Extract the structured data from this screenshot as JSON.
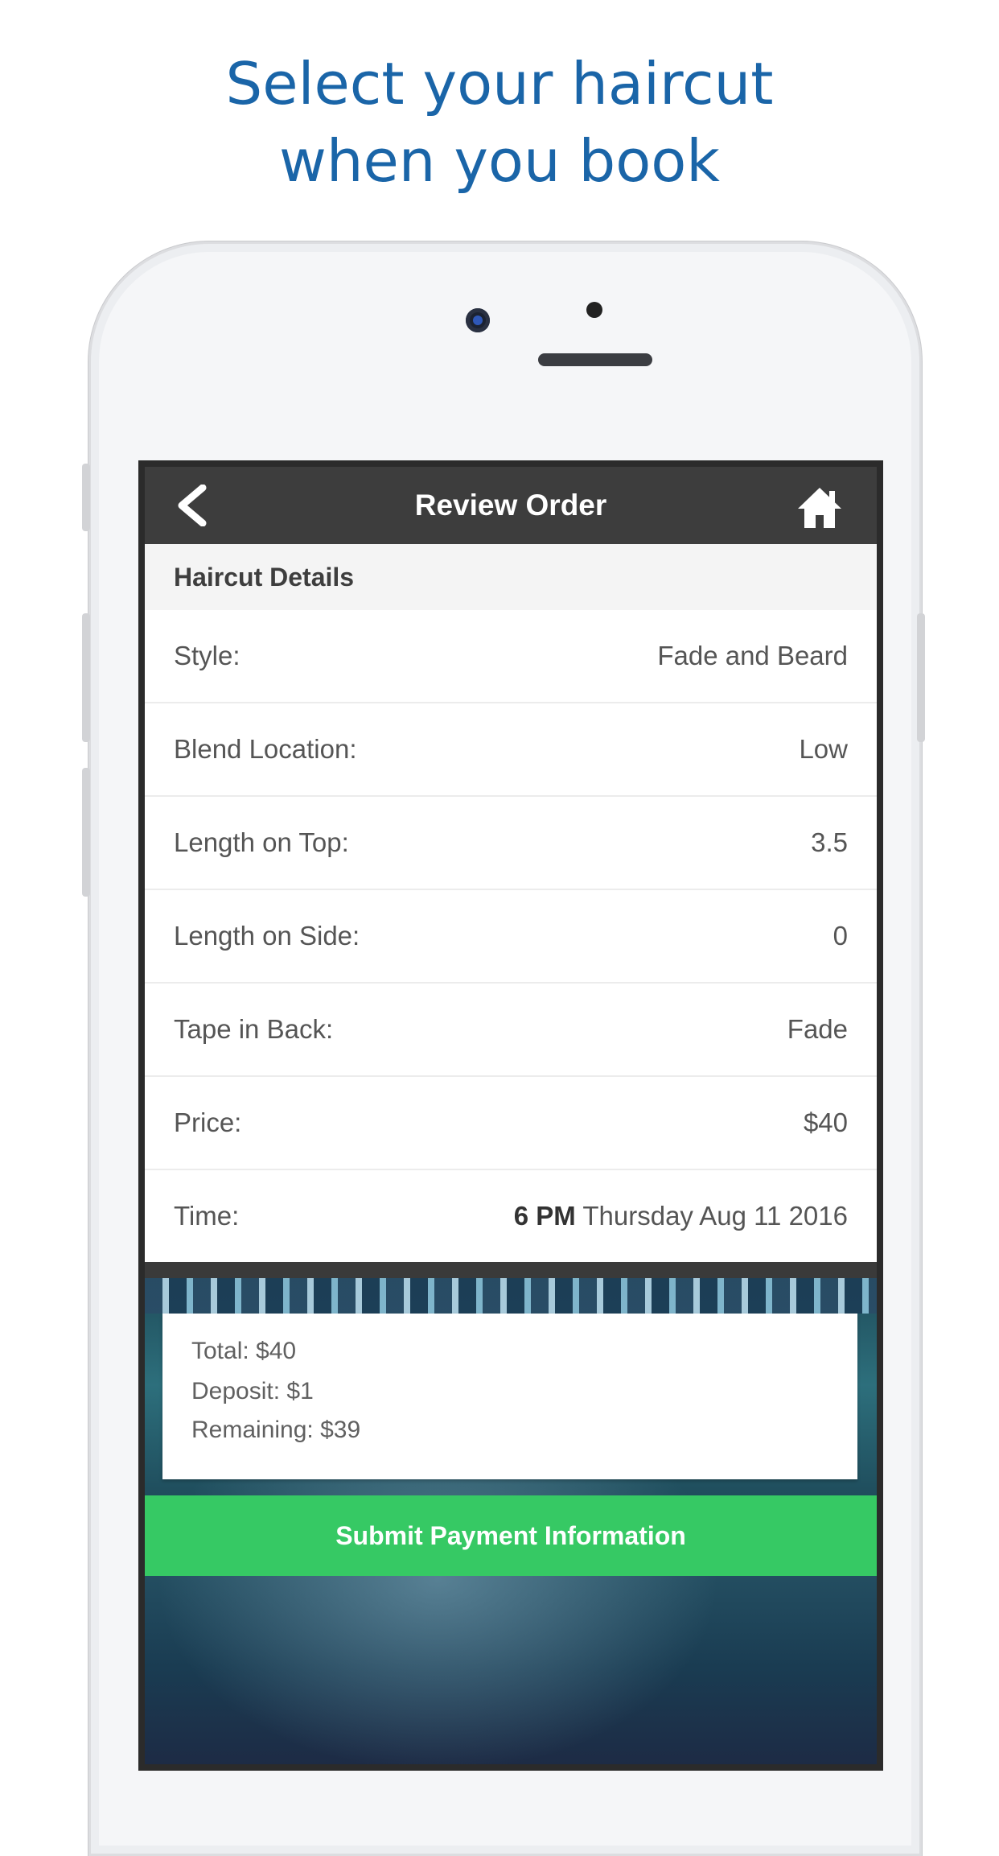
{
  "headline": {
    "line1": "Select your haircut",
    "line2": "when you book"
  },
  "navbar": {
    "title": "Review Order",
    "back_icon": "chevron-left-icon",
    "home_icon": "home-icon"
  },
  "section": {
    "title": "Haircut Details"
  },
  "details": [
    {
      "label": "Style:",
      "value": "Fade and Beard"
    },
    {
      "label": "Blend Location:",
      "value": "Low"
    },
    {
      "label": "Length on Top:",
      "value": "3.5"
    },
    {
      "label": "Length on Side:",
      "value": "0"
    },
    {
      "label": "Tape in Back:",
      "value": "Fade"
    },
    {
      "label": "Price:",
      "value": "$40"
    }
  ],
  "time": {
    "label": "Time:",
    "hour": "6 PM",
    "date": "Thursday Aug 11 2016"
  },
  "summary": {
    "total": "Total: $40",
    "deposit": "Deposit: $1",
    "remaining": "Remaining: $39"
  },
  "submit": {
    "label": "Submit Payment Information",
    "color": "#36c964"
  },
  "colors": {
    "headline": "#1a65a8",
    "navbar": "#3d3d3d"
  }
}
